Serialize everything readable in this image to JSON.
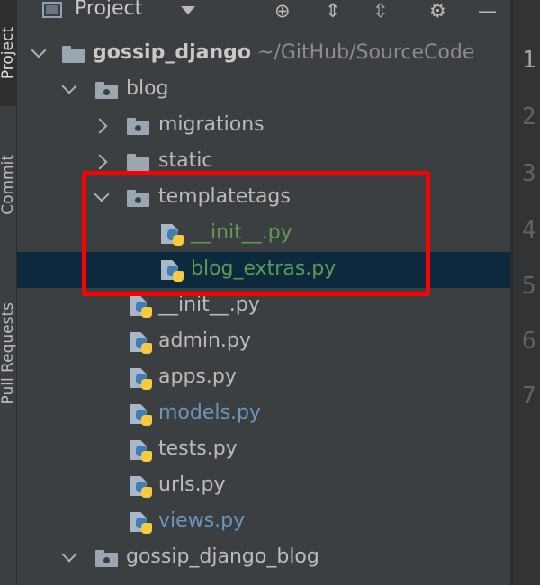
{
  "side_tabs": {
    "project": "Project",
    "commit": "Commit",
    "pull_requests": "Pull Requests"
  },
  "header": {
    "title": "Project",
    "icons": [
      "project-icon",
      "dropdown-icon",
      "locate-icon",
      "expand-all-icon",
      "collapse-all-icon",
      "gear-icon",
      "minimize-icon"
    ]
  },
  "tree": {
    "root": {
      "name": "gossip_django",
      "path": "~/GitHub/SourceCode"
    },
    "blog": "blog",
    "migrations": "migrations",
    "static": "static",
    "templatetags": "templatetags",
    "tt_init": "__init__.py",
    "tt_blog_extras": "blog_extras.py",
    "blog_init": "__init__.py",
    "admin": "admin.py",
    "apps": "apps.py",
    "models": "models.py",
    "tests": "tests.py",
    "urls": "urls.py",
    "views": "views.py",
    "gossip_blog": "gossip_django_blog"
  },
  "line_numbers": [
    "1",
    "2",
    "3",
    "4",
    "5",
    "6",
    "7"
  ],
  "colors": {
    "highlight_box": "#ff0000",
    "selected_row": "#0d293e",
    "new_file_green": "#629755",
    "modified_blue": "#6897bb"
  }
}
